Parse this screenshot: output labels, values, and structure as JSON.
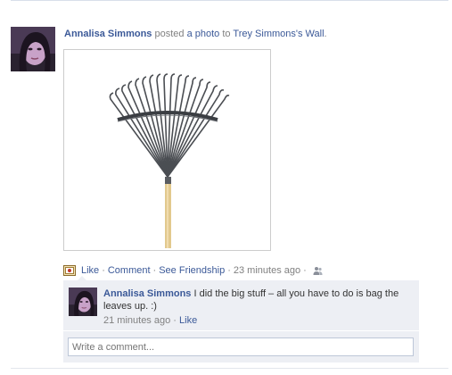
{
  "story": {
    "author": "Annalisa Simmons",
    "verb": "posted",
    "object_link": "a photo",
    "preposition": "to",
    "target": "Trey Simmons's Wall",
    "period": "."
  },
  "actions": {
    "like": "Like",
    "comment": "Comment",
    "see_friendship": "See Friendship",
    "separator": "·",
    "timestamp": "23 minutes ago",
    "icon": "photo-icon",
    "privacy_icon": "friends-icon"
  },
  "comments": [
    {
      "author": "Annalisa Simmons",
      "text": "I did the big stuff – all you have to do is bag the leaves up. :)",
      "timestamp": "21 minutes ago",
      "like": "Like"
    }
  ],
  "comment_input": {
    "placeholder": "Write a comment..."
  },
  "colors": {
    "link": "#3b5998",
    "muted": "#808080",
    "comment_bg": "#edeff4",
    "input_border": "#bdc7d8"
  }
}
